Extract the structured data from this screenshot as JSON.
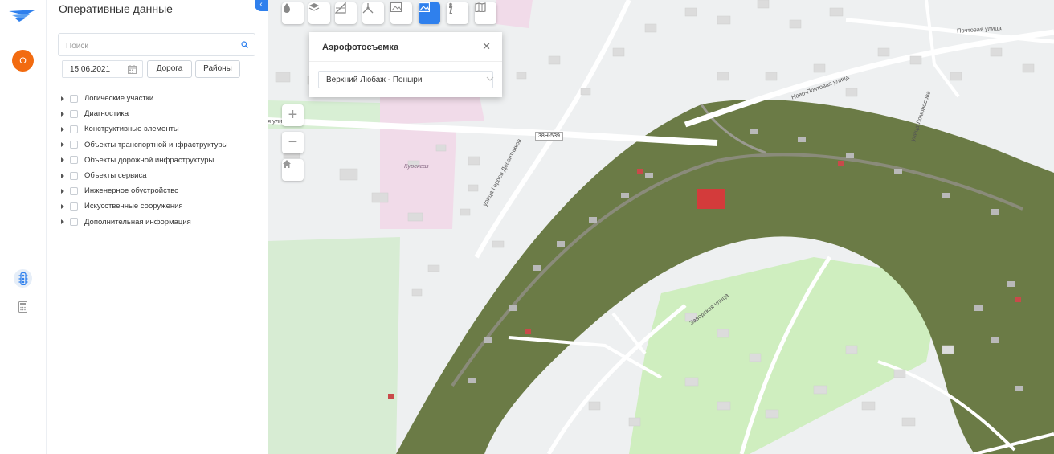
{
  "sidebar": {
    "avatar_initial": "О"
  },
  "panel": {
    "title": "Оперативные данные",
    "search_placeholder": "Поиск",
    "date_value": "15.06.2021",
    "road_button": "Дорога",
    "districts_button": "Районы",
    "tree": [
      {
        "label": "Логические участки"
      },
      {
        "label": "Диагностика"
      },
      {
        "label": "Конструктивные элементы"
      },
      {
        "label": "Объекты транспортной инфраструктуры"
      },
      {
        "label": "Объекты дорожной инфраструктуры"
      },
      {
        "label": "Объекты сервиса"
      },
      {
        "label": "Инженерное обустройство"
      },
      {
        "label": "Искусственные сооружения"
      },
      {
        "label": "Дополнительная информация"
      }
    ]
  },
  "map": {
    "popup": {
      "title": "Аэрофотосъемка",
      "selected": "Верхний Любаж - Поныри"
    },
    "labels": {
      "shield": "38Н-539",
      "kurskgaz": "Курскгаз",
      "pochtovaya": "Почтовая улица",
      "novo_pochtovaya": "Ново-Почтовая улица",
      "lomonosova": "улица Ломоносова",
      "geroev": "улица Героев Десантников",
      "zavodskaya": "Заводская улица",
      "ulitsa_left": "я ули"
    }
  },
  "colors": {
    "accent": "#2f80ed",
    "avatar": "#f26b10"
  }
}
